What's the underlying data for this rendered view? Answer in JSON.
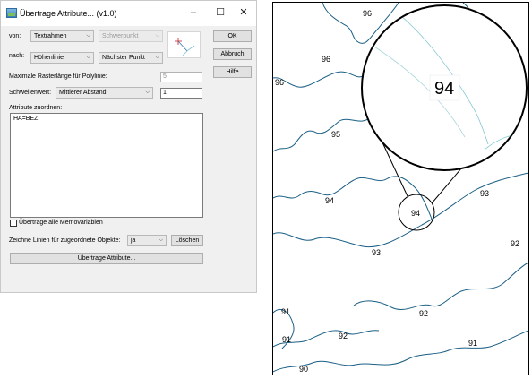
{
  "window": {
    "title": "Übertrage Attribute... (v1.0)",
    "minimize": "–",
    "maximize": "☐",
    "close": "✕"
  },
  "form": {
    "von_label": "von:",
    "von_value": "Textrahmen",
    "von_secondary": "Schwerpunkt",
    "nach_label": "nach:",
    "nach_value": "Höhenlinie",
    "nach_secondary": "Nächster Punkt",
    "raster_label": "Maximale Rasterlänge für Polylinie:",
    "raster_value": "5",
    "schwelle_label": "Schwellenwert:",
    "schwelle_mode": "Mittlerer Abstand",
    "schwelle_value": "1",
    "attribute_label": "Attribute zuordnen:",
    "attribute_text": "HA=BEZ",
    "memo_label": "Übertrage alle Memovariablen",
    "lines_label": "Zeichne Linien für zugeordnete Objekte:",
    "lines_value": "ja",
    "delete_label": "Löschen",
    "transfer_label": "Übertrage Attribute..."
  },
  "buttons": {
    "ok": "OK",
    "cancel": "Abbruch",
    "help": "Hilfe"
  },
  "map": {
    "magnified_label": "94",
    "contour_labels": [
      "96",
      "96",
      "96",
      "95",
      "94",
      "94",
      "93",
      "93",
      "92",
      "92",
      "92",
      "91",
      "91",
      "91",
      "90"
    ]
  },
  "icons": {
    "combo_arrow": "chevron-down-icon",
    "app": "app-icon"
  }
}
